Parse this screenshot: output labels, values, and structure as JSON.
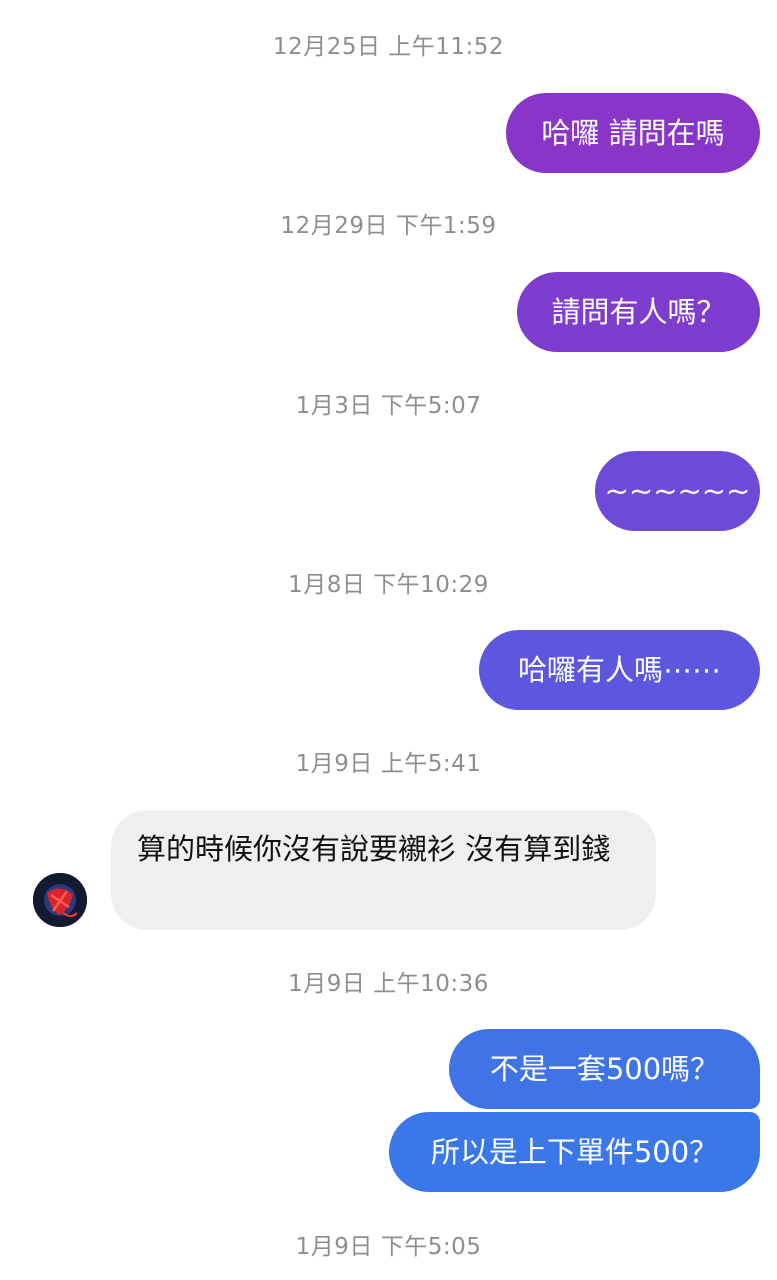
{
  "conversation": {
    "timestamps": [
      "12月25日 上午11:52",
      "12月29日 下午1:59",
      "1月3日 下午5:07",
      "1月8日 下午10:29",
      "1月9日 上午5:41",
      "1月9日 上午10:36",
      "1月9日 下午5:05"
    ],
    "messages": {
      "m1": "哈囉 請問在嗎",
      "m2": "請問有人嗎？",
      "m3": "~~~~~~",
      "m4": "哈囉有人嗎⋯⋯",
      "m5": "算的時候你沒有說要襯衫 沒有算到錢",
      "m6": "不是一套500嗎？",
      "m7": "所以是上下單件500？"
    }
  },
  "colors": {
    "bubble_gradient": [
      "#8a35c9",
      "#7c3fd0",
      "#6e4ad8",
      "#5d57df",
      "#3f73e6",
      "#3a77e8"
    ],
    "received_bubble": "#efefef",
    "timestamp_text": "#8e8e8e"
  },
  "icons": {
    "avatar": "contact-avatar"
  }
}
